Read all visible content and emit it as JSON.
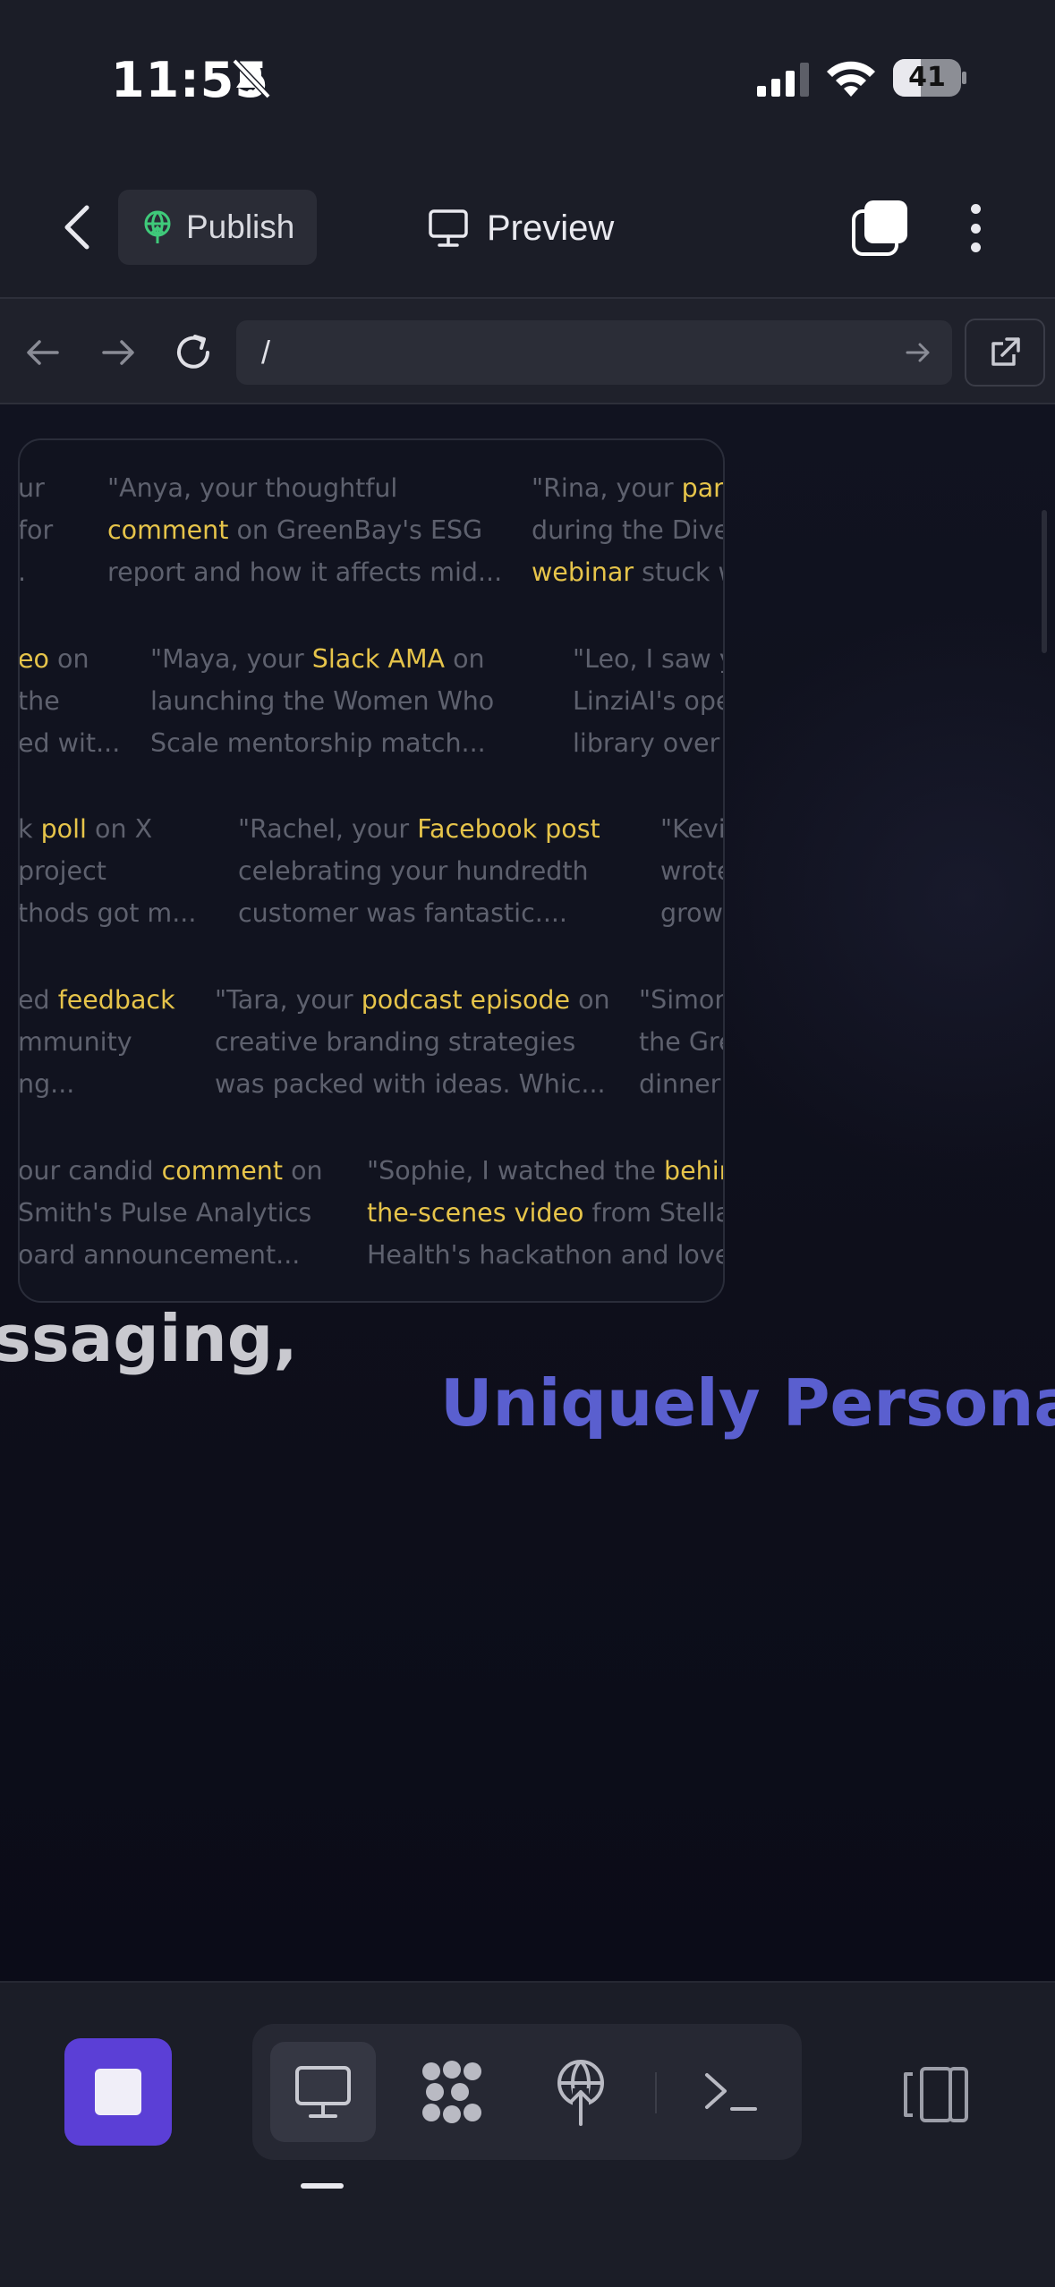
{
  "status_bar": {
    "time": "11:55",
    "battery_level": "41",
    "battery_fraction": 0.41
  },
  "header": {
    "back_icon": "chevron-left-icon",
    "publish_label": "Publish",
    "preview_label": "Preview"
  },
  "browser": {
    "url": "/"
  },
  "preview": {
    "quotes": [
      {
        "before": "\"Anya, your thoughtful",
        "hl": "comment",
        "after": " on GreenBay's ESG",
        "line3": "report and how it affects mid..."
      },
      {
        "before": "\"Rina, your ",
        "hl": "pane",
        "after": "",
        "line2": "during the Diver",
        "hl2": "webinar",
        "after2": " stuck w"
      },
      {
        "line1a": "\"Maya, your ",
        "hl": "Slack AMA",
        "line1b": " on",
        "line2": "launching the Women Who",
        "line3": "Scale mentorship match..."
      },
      {
        "line1": "\"Leo, I saw yo",
        "line2": "LinziAI's ope",
        "line3": "library over c"
      },
      {
        "line1a": "\"Rachel, your ",
        "hl": "Facebook post",
        "line2": "celebrating your hundredth",
        "line3": "customer was fantastic...."
      },
      {
        "line1": "\"Kevin",
        "line2": "wrote",
        "line3": "grow"
      },
      {
        "line1a": "\"Tara, your ",
        "hl": "podcast episode",
        "line1b": " on",
        "line2": "creative branding strategies",
        "line3": "was packed with ideas. Whic..."
      },
      {
        "line1": "\"Simon",
        "line2": "the Gre",
        "line3": "dinner"
      },
      {
        "line1a": "our candid ",
        "hl": "comment",
        "line1b": " on",
        "line2": "Smith's Pulse Analytics",
        "line3": "oard announcement..."
      },
      {
        "line1a": "\"Sophie, I watched the ",
        "hl": "behind",
        "hl2": "the-scenes video",
        "line2b": " from Stella",
        "line3": "Health's hackathon and loved"
      },
      {
        "line1": "ur",
        "line2": "for",
        "line3": "."
      },
      {
        "hl": "eo",
        "line1b": " on",
        "line2": "the",
        "line3": "ed wit..."
      },
      {
        "line1a": "k ",
        "hl": "poll",
        "line1b": " on X",
        "line2": "project",
        "line3": "thods got m..."
      },
      {
        "line1a": "ed ",
        "hl": "feedback",
        "line2": "mmunity",
        "line3": "ng..."
      }
    ],
    "headline": "ssaging,",
    "subline": "Uniquely Personal."
  },
  "toolbar": {
    "tools": [
      "monitor-icon",
      "grid-icon",
      "publish-icon",
      "terminal-icon"
    ]
  },
  "colors": {
    "accent": "#5b3fd6",
    "highlight": "#e6c44a",
    "subline": "#5a5fcf"
  }
}
